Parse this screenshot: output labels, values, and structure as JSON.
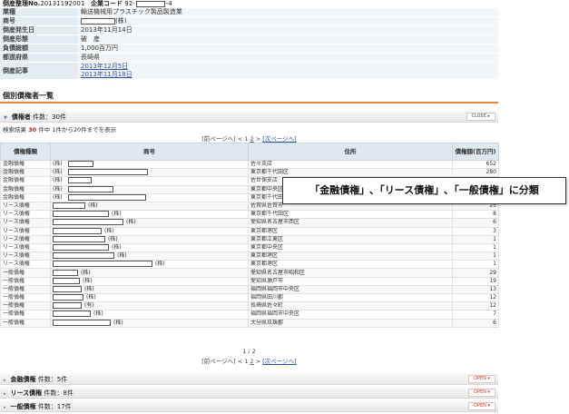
{
  "header": {
    "doc_no_label": "倒産整理No.",
    "doc_no": "20131192001",
    "company_code_label": "企業コード",
    "company_code_prefix": "92-",
    "company_code_suffix": "-4"
  },
  "info": [
    {
      "key": "業種",
      "value": "輸送機械用プラスチック製品製造業"
    },
    {
      "key": "商号",
      "value": "(株)"
    },
    {
      "key": "倒産発生日",
      "value": "2013年11月14日"
    },
    {
      "key": "倒産形態",
      "value": "破　産"
    },
    {
      "key": "負債総額",
      "value": "1,000百万円"
    },
    {
      "key": "都道府県",
      "value": "長崎県"
    },
    {
      "key": "倒産記事",
      "links": [
        "2013年12月5日",
        "2013年11月18日"
      ]
    }
  ],
  "section_title": "個別債権者一覧",
  "creditor_bar": {
    "label": "債権者",
    "count": "件数：30件",
    "button": "CLOSE"
  },
  "stats": {
    "prefix": "検索結果",
    "count": "30",
    "suffix": "件中 1件から20件までを表示"
  },
  "pager": {
    "prev": "[前ページへ]",
    "sep1": " < ",
    "p1": "1",
    "p2": "2",
    "sep2": " > ",
    "next": "[次ページへ]",
    "page_info": "1 / 2"
  },
  "table": {
    "headers": {
      "type": "債権種類",
      "name": "商号",
      "address": "住所",
      "amount": "債権額(百万円)"
    },
    "rows": [
      {
        "type": "金融債権",
        "name": "(株)",
        "address": "佐々支店",
        "amount": "652"
      },
      {
        "type": "金融債権",
        "name": "(株)",
        "address": "東京都千代田区",
        "amount": "280"
      },
      {
        "type": "金融債権",
        "name": "(株)",
        "address": "佐世保支店",
        "amount": ""
      },
      {
        "type": "金融債権",
        "name": "(株)",
        "address": "東京都中央区",
        "amount": ""
      },
      {
        "type": "金融債権",
        "name": "(株)",
        "address": "東京都千代田区",
        "amount": ""
      },
      {
        "type": "リース債権",
        "name": "(株)",
        "address": "佐賀県佐賀市",
        "amount": "25"
      },
      {
        "type": "リース債権",
        "name": "(株)",
        "address": "東京都千代田区",
        "amount": "8"
      },
      {
        "type": "リース債権",
        "name": "(株)",
        "address": "愛知県名古屋市西区",
        "amount": "6"
      },
      {
        "type": "リース債権",
        "name": "(株)",
        "address": "東京都港区",
        "amount": "3"
      },
      {
        "type": "リース債権",
        "name": "(株)",
        "address": "東京都江東区",
        "amount": "1"
      },
      {
        "type": "リース債権",
        "name": "(株)",
        "address": "東京都中央区",
        "amount": "1"
      },
      {
        "type": "リース債権",
        "name": "(株)",
        "address": "東京都港区",
        "amount": "1"
      },
      {
        "type": "リース債権",
        "name": "(株)",
        "address": "東京都港区",
        "amount": "1"
      },
      {
        "type": "一般債権",
        "name": "(株)",
        "address": "愛知県名古屋市昭和区",
        "amount": "29"
      },
      {
        "type": "一般債権",
        "name": "(株)",
        "address": "愛知県瀬戸市",
        "amount": "19"
      },
      {
        "type": "一般債権",
        "name": "(株)",
        "address": "福岡県福岡市中央区",
        "amount": "13"
      },
      {
        "type": "一般債権",
        "name": "(株)",
        "address": "福岡県田川郡",
        "amount": "12"
      },
      {
        "type": "一般債権",
        "name": "(有)",
        "address": "長崎県佐々町",
        "amount": "12"
      },
      {
        "type": "一般債権",
        "name": "(株)",
        "address": "福岡県福岡市中央区",
        "amount": "7"
      },
      {
        "type": "一般債権",
        "name": "(株)",
        "address": "大分県玖珠郡",
        "amount": "6"
      }
    ]
  },
  "group_bars": [
    {
      "label": "金融債権",
      "count": "件数：5件",
      "button": "OPEN"
    },
    {
      "label": "リース債権",
      "count": "件数：8件",
      "button": "OPEN"
    },
    {
      "label": "一般債権",
      "count": "件数：17件",
      "button": "OPEN"
    }
  ],
  "callout": "「金融債権」､「リース債権」､「一般債権」に分類"
}
